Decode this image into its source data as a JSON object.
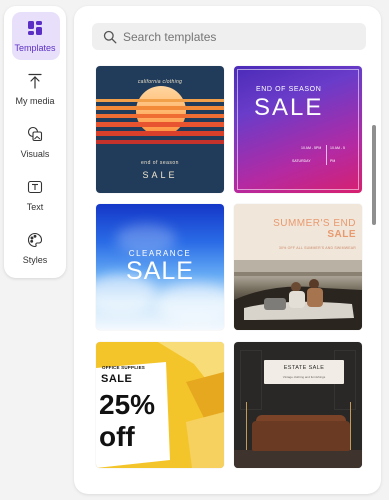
{
  "rail": {
    "items": [
      {
        "label": "Templates",
        "icon": "templates-icon",
        "active": true
      },
      {
        "label": "My media",
        "icon": "upload-icon",
        "active": false
      },
      {
        "label": "Visuals",
        "icon": "visuals-icon",
        "active": false
      },
      {
        "label": "Text",
        "icon": "text-icon",
        "active": false
      },
      {
        "label": "Styles",
        "icon": "palette-icon",
        "active": false
      }
    ],
    "accent_color": "#5b2fc6"
  },
  "search": {
    "placeholder": "Search templates"
  },
  "templates": [
    {
      "name": "sunset-sale",
      "top_text": "california clothing",
      "line1": "end of season",
      "line2": "SALE"
    },
    {
      "name": "end-of-season-sale",
      "line1": "END OF SEASON",
      "line2": "SALE",
      "meta1": "10 AM - 5",
      "meta2": "PM",
      "meta3": "SATURDAY",
      "meta4": "10 AM - 5",
      "meta5": "PM"
    },
    {
      "name": "clearance-sale",
      "line1": "CLEARANCE",
      "line2": "SALE"
    },
    {
      "name": "summers-end-sale",
      "line1": "SUMMER'S END",
      "line2": "SALE",
      "sub": "30% OFF ALL SUMMER'S AND SWIMWEAR"
    },
    {
      "name": "office-supplies-sale",
      "line1": "OFFICE SUPPLIES",
      "line2": "SALE",
      "line3": "25%",
      "line4": "off"
    },
    {
      "name": "estate-sale",
      "line1": "ESTATE SALE",
      "sub": "Vintage clothing and furnishings"
    }
  ]
}
